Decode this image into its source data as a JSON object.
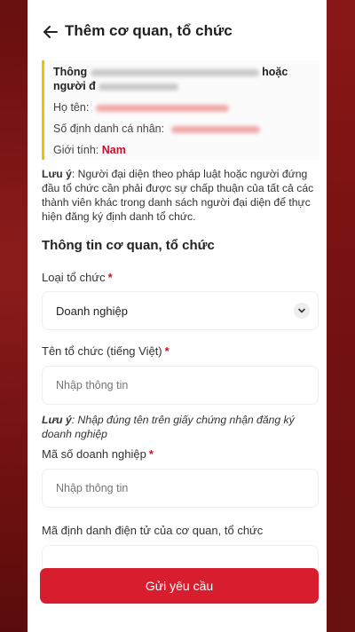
{
  "header": {
    "title": "Thêm cơ quan, tổ chức"
  },
  "info": {
    "heading_start": "Thông",
    "heading_end": "hoặc",
    "heading_line2": "người đ",
    "name_label": "Họ tên:",
    "id_label": "Số định danh cá nhân:",
    "gender_label": "Giới tính:",
    "gender_value": "Nam"
  },
  "note1": {
    "prefix": "Lưu ý",
    "text": ": Người đại diện theo pháp luật hoặc người đứng đầu tổ chức cần phải được sự chấp thuận của tất cả các thành viên khác trong danh sách người đại diện để thực hiện đăng ký định danh tổ chức."
  },
  "section": {
    "title": "Thông tin cơ quan, tổ chức"
  },
  "fields": {
    "org_type": {
      "label": "Loại tổ chức",
      "required": "*",
      "value": "Doanh nghiệp"
    },
    "org_name": {
      "label": "Tên tổ chức (tiếng Việt)",
      "required": "*",
      "placeholder": "Nhập thông tin"
    },
    "tax_code": {
      "label": "Mã số doanh nghiệp",
      "required": "*",
      "placeholder": "Nhập thông tin"
    },
    "e_id": {
      "label": "Mã định danh điện tử của cơ quan, tổ chức"
    }
  },
  "note2": {
    "prefix": "Lưu ý",
    "text": ": Nhập đúng tên trên giấy chứng nhận đăng ký doanh nghiệp"
  },
  "submit": {
    "label": "Gửi yêu cầu"
  },
  "colors": {
    "accent": "#d81e2e",
    "highlight": "#f2c200",
    "required": "#c8102e"
  }
}
